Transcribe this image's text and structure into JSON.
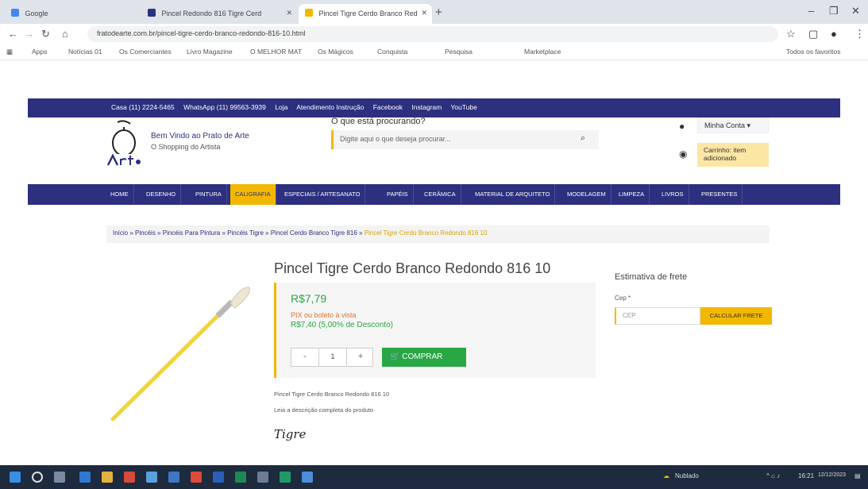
{
  "browser": {
    "tabs": [
      {
        "label": "Google",
        "active": false
      },
      {
        "label": "Pincel Redondo 816 Tigre Cerd",
        "active": false
      },
      {
        "label": "Pincel Tigre Cerdo Branco Red",
        "active": true
      }
    ],
    "new_tab_label": "+",
    "url": "fratodearte.com.br/pincel-tigre-cerdo-branco-redondo-816-10.html",
    "bookmarks": [
      "Apps",
      "Notícias 01",
      "Os Comerciantes",
      "Livro Magazine",
      "O MELHOR MAT",
      "Os Mágicos",
      "Conquista",
      "Pesquisa",
      "Marketplace",
      "Todos os favoritos"
    ]
  },
  "site": {
    "topbar": [
      "Casa (11) 2224-5465",
      "WhatsApp (11) 99563-3939",
      "Loja",
      "Atendimento Instrução",
      "Facebook",
      "Instagram",
      "YouTube"
    ],
    "welcome_title": "Bem Vindo ao Prato de Arte",
    "welcome_sub": "O Shopping do Artista",
    "search_label": "O que está procurando?",
    "search_placeholder": "Digite aqui o que deseja procurar...",
    "user_label": "Minha Conta",
    "cart_label": "Carrinho: item adicionado",
    "categories": [
      "HOME",
      "DESENHO",
      "PINTURA",
      "CALIGRAFIA",
      "ESPECIAIS / ARTESANATO",
      "PAPÉIS",
      "CERÂMICA",
      "MATERIAL DE ARQUITETO",
      "MODELAGEM",
      "LIMPEZA",
      "LIVROS",
      "PRESENTES"
    ],
    "breadcrumb": [
      "Início",
      "Pincéis",
      "Pincéis Para Pintura",
      "Pincéis Tigre",
      "Pincel Cerdo Branco Tigre 816"
    ],
    "breadcrumb_last": "Pincel Tigre Cerdo Branco Redondo 816 10"
  },
  "product": {
    "title": "Pincel Tigre Cerdo Branco Redondo 816 10",
    "price": "R$7,79",
    "pix_note": "PIX ou boleto à vista",
    "discount": "R$7,40 (5,00% de Desconto)",
    "qty_minus": "-",
    "quantity": "1",
    "qty_plus": "+",
    "buy_label": "COMPRAR",
    "description_line1": "Pincel Tigre Cerdo Branco Redondo 816 10",
    "description_line2": "Leia a descrição completa do produto",
    "brand": "Tigre"
  },
  "shipping": {
    "title": "Estimativa de frete",
    "cep_label": "Cep *",
    "cep_placeholder": "CEP",
    "button_label": "CALCULAR FRETE"
  },
  "taskbar": {
    "weather": "Nublado",
    "time": "16:21",
    "date": "12/12/2023"
  },
  "colors": {
    "site_primary": "#2d2f7f",
    "accent_yellow": "#f2b800",
    "price_green": "#28a745"
  }
}
